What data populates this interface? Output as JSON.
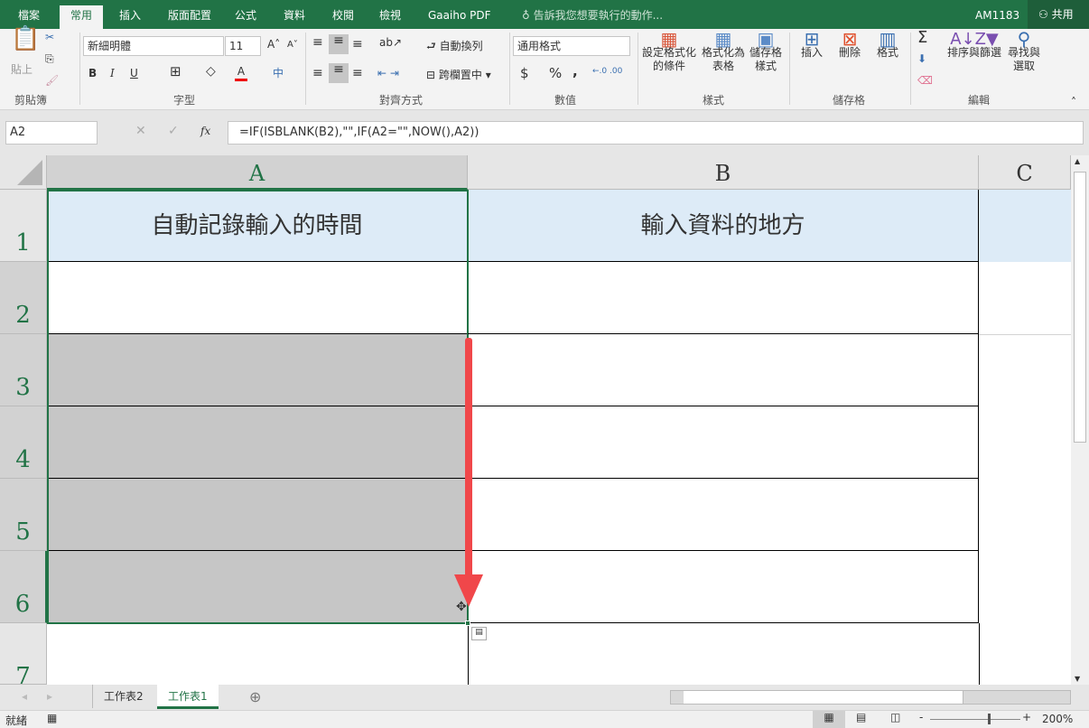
{
  "ribbon_tabs": [
    "檔案",
    "常用",
    "插入",
    "版面配置",
    "公式",
    "資料",
    "校閱",
    "檢視",
    "Gaaiho PDF"
  ],
  "active_tab": "常用",
  "tell_me": "告訴我您想要執行的動作...",
  "user": "AM1183",
  "share": "共用",
  "clipboard": {
    "paste": "貼上",
    "group": "剪貼簿"
  },
  "font": {
    "name": "新細明體",
    "size": "11",
    "group": "字型",
    "bold": "B",
    "italic": "I",
    "underline": "U",
    "font_color": "A"
  },
  "alignment": {
    "wrap": "自動換列",
    "merge": "跨欄置中",
    "group": "對齊方式"
  },
  "number": {
    "format": "通用格式",
    "currency": "$",
    "percent": "%",
    "comma": ",",
    "group": "數值"
  },
  "styles": {
    "cond": "設定格式化的條件",
    "table": "格式化為表格",
    "cell": "儲存格樣式",
    "group": "樣式"
  },
  "cells": {
    "insert": "插入",
    "delete": "刪除",
    "format": "格式",
    "group": "儲存格"
  },
  "editing": {
    "sort": "排序與篩選",
    "find": "尋找與選取",
    "group": "編輯"
  },
  "name_box": "A2",
  "formula": "=IF(ISBLANK(B2),\"\",IF(A2=\"\",NOW(),A2))",
  "fx": "fx",
  "columns": [
    "A",
    "B",
    "C"
  ],
  "rows": [
    "1",
    "2",
    "3",
    "4",
    "5",
    "6",
    "7"
  ],
  "cells_data": {
    "A1": "自動記錄輸入的時間",
    "B1": "輸入資料的地方"
  },
  "sheets": [
    "工作表2",
    "工作表1"
  ],
  "active_sheet": "工作表1",
  "status": "就緒",
  "zoom": "200%",
  "colors": {
    "green": "#217346",
    "header_fill": "#ddebf7",
    "selection": "#c6c6c6",
    "arrow": "#f0474a"
  }
}
